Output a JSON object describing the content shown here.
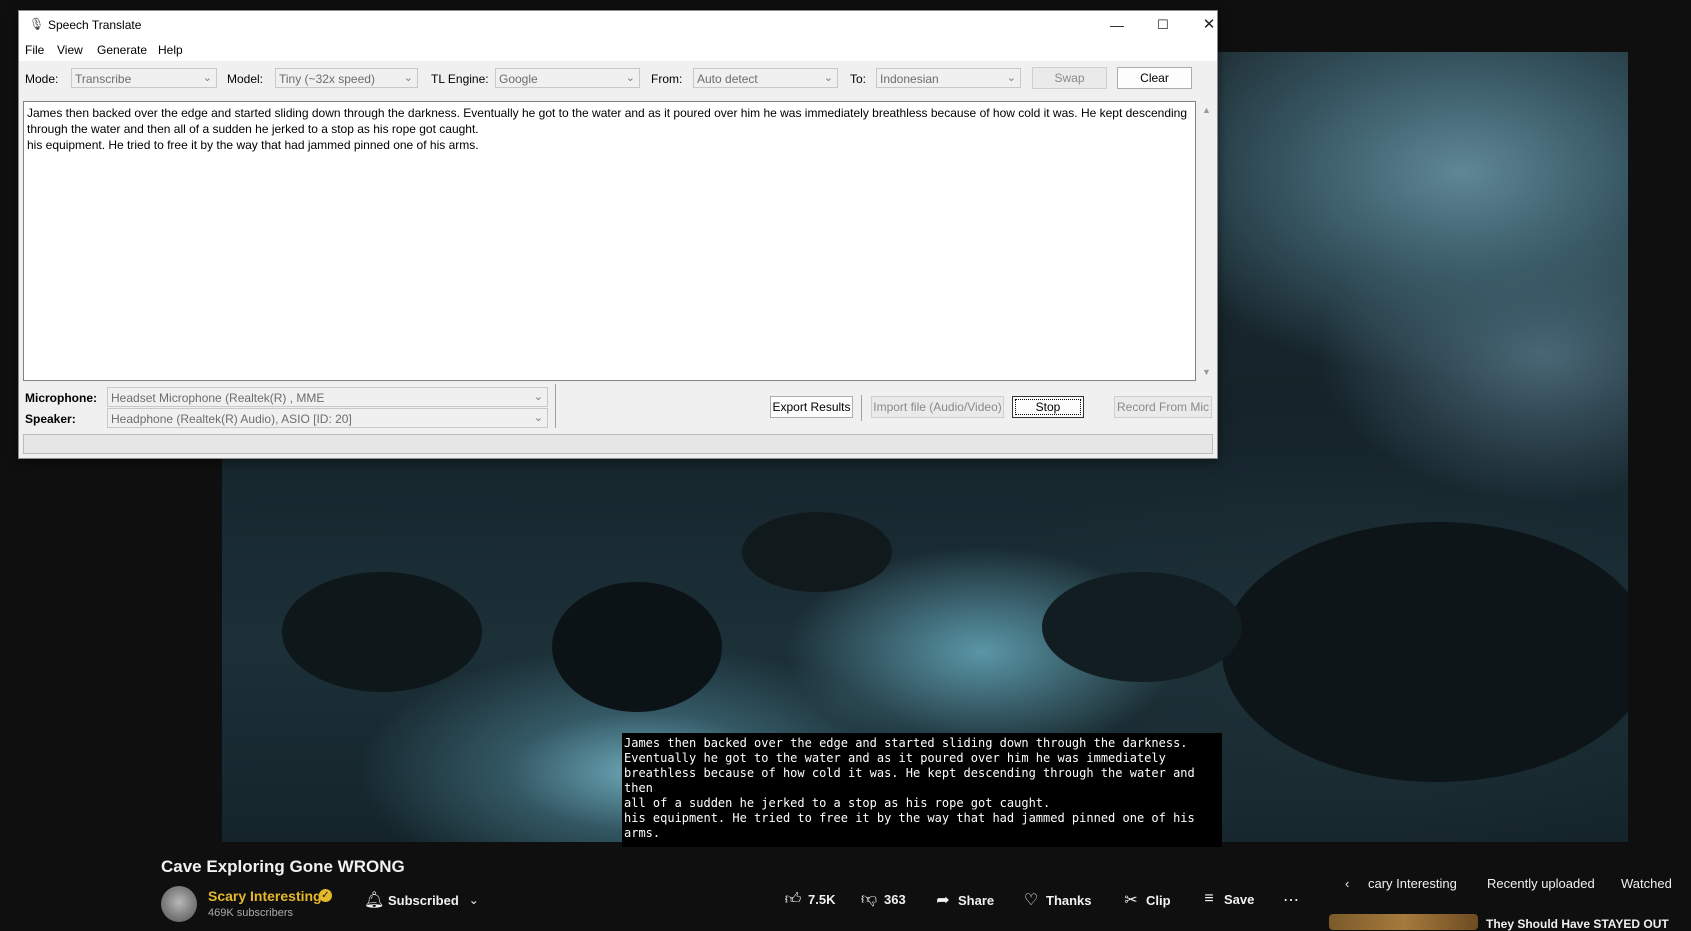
{
  "app": {
    "title": "Speech Translate",
    "icon": "microphone-icon",
    "menu": [
      "File",
      "View",
      "Generate",
      "Help"
    ],
    "toolbar": {
      "mode_label": "Mode:",
      "mode_value": "Transcribe",
      "model_label": "Model:",
      "model_value": "Tiny (~32x speed)",
      "engine_label": "TL Engine:",
      "engine_value": "Google",
      "from_label": "From:",
      "from_value": "Auto detect",
      "to_label": "To:",
      "to_value": "Indonesian",
      "swap_label": "Swap",
      "clear_label": "Clear"
    },
    "transcript": "James then backed over the edge and started sliding down through the darkness. Eventually he got to the water and as it poured over him he was immediately breathless because of how cold it was. He kept descending through the water and then all of a sudden he jerked to a stop as his rope got caught.\nhis equipment. He tried to free it by the way that had jammed pinned one of his arms.",
    "devices": {
      "mic_label": "Microphone:",
      "mic_value": "Headset Microphone (Realtek(R) , MME",
      "speaker_label": "Speaker:",
      "speaker_value": "Headphone (Realtek(R) Audio), ASIO [ID: 20]"
    },
    "actions": {
      "export_label": "Export Results",
      "import_label": "Import file (Audio/Video)",
      "stop_label": "Stop",
      "record_label": "Record From Mic"
    }
  },
  "video": {
    "subtitle": "James then backed over the edge and started sliding down through the darkness.\nEventually he got to the water and as it poured over him he was immediately\nbreathless because of how cold it was. He kept descending through the water and then\nall of a sudden he jerked to a stop as his rope got caught.\nhis equipment. He tried to free it by the way that had jammed pinned one of his arms.",
    "title": "Cave Exploring Gone WRONG",
    "channel_name": "Scary Interesting",
    "subscribers": "469K subscribers",
    "subscribed_label": "Subscribed",
    "likes": "7.5K",
    "dislikes": "363",
    "share_label": "Share",
    "thanks_label": "Thanks",
    "clip_label": "Clip",
    "save_label": "Save",
    "chips": [
      "cary Interesting",
      "Recently uploaded",
      "Watched"
    ],
    "next_video_title": "They Should Have STAYED OUT"
  },
  "colors": {
    "channel_accent": "#e5b82b",
    "page_bg": "#0f0f0f",
    "window_bg": "#f0f0f0"
  }
}
